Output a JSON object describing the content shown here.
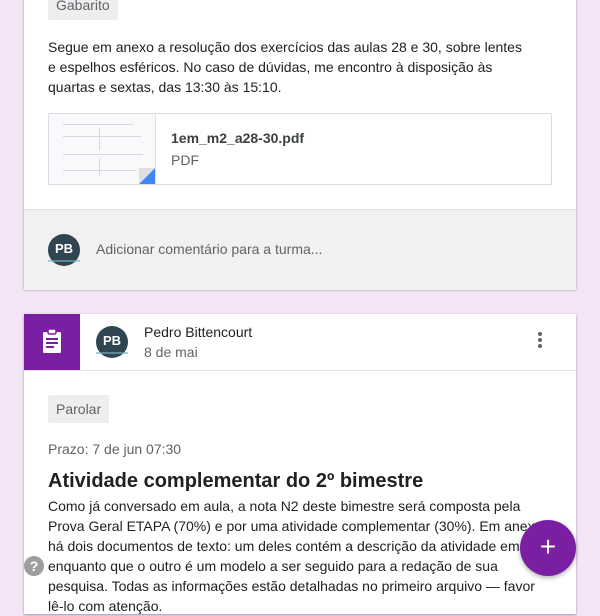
{
  "post1": {
    "topic_chip": "Gabarito",
    "description": "Segue em anexo a resolução dos exercícios das aulas 28 e 30, sobre lentes e espelhos esféricos. No caso de dúvidas, me encontro à disposição às quartas e sextas, das 13:30 às 15:10.",
    "attachment": {
      "filename": "1em_m2_a28-30.pdf",
      "type": "PDF"
    },
    "comment_placeholder": "Adicionar comentário para a turma..."
  },
  "post2": {
    "author": "Pedro Bittencourt",
    "date": "8 de mai",
    "topic_chip": "Parolar",
    "due": "Prazo: 7 de jun 07:30",
    "title": "Atividade complementar do 2º bimestre",
    "body": "Como já conversado em aula, a nota N2 deste bimestre será composta pela Prova Geral ETAPA (70%) e por uma atividade complementar (30%). Em anexo há dois documentos de texto: um deles contém a descrição da atividade em si, enquanto que o outro é um modelo a ser seguido para a redação de sua pesquisa. Todas as informações estão detalhadas no primeiro arquivo — favor lê-lo com atenção."
  },
  "avatar_initials": "PB",
  "fab_label": "+",
  "help_label": "?",
  "colors": {
    "accent": "#7b1fa2",
    "background": "#f3e5f5"
  }
}
